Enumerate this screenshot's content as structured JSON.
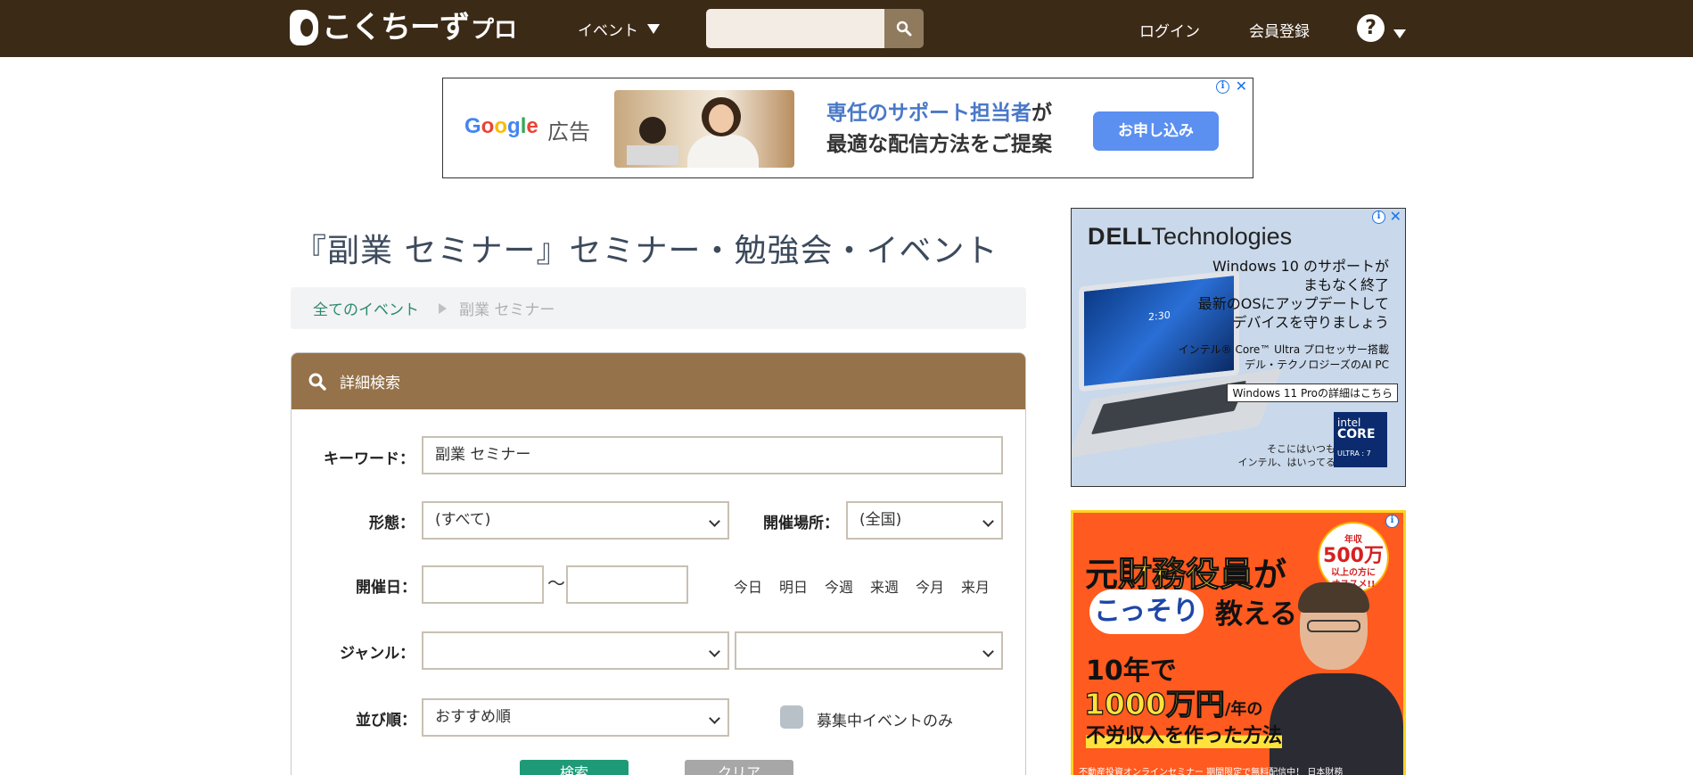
{
  "header": {
    "logo_main": "こくちーず",
    "logo_sub": "プロ",
    "nav_event": "イベント",
    "search_placeholder": "",
    "login": "ログイン",
    "signup": "会員登録",
    "help": "?"
  },
  "ad_top": {
    "brand_label": "広告",
    "copy_line1_highlight": "専任のサポート担当者",
    "copy_line1_rest": "が",
    "copy_line2": "最適な配信方法をご提案",
    "cta": "お申し込み"
  },
  "page": {
    "title": "『副業 セミナー』セミナー・勉強会・イベント"
  },
  "breadcrumb": {
    "home": "全てのイベント",
    "current": "副業 セミナー"
  },
  "search_panel": {
    "heading": "詳細検索",
    "keyword_label": "キーワード：",
    "keyword_value": "副業 セミナー",
    "type_label": "形態：",
    "type_value": "(すべて)",
    "place_label": "開催場所：",
    "place_value": "(全国)",
    "date_label": "開催日：",
    "date_from": "",
    "date_sep": "〜",
    "date_to": "",
    "quick_dates": [
      "今日",
      "明日",
      "今週",
      "来週",
      "今月",
      "来月"
    ],
    "genre_label": "ジャンル：",
    "genre1_value": "",
    "genre2_value": "",
    "sort_label": "並び順：",
    "sort_value": "おすすめ順",
    "open_only_label": "募集中イベントのみ",
    "search_button": "検索",
    "clear_button": "クリア"
  },
  "ad_dell": {
    "logo_d": "D",
    "logo_ell": "ELL",
    "logo_rest": "Technologies",
    "copy1": "Windows 10 のサポートが",
    "copy2": "まもなく終了",
    "copy3": "最新のOSにアップデートして",
    "copy4": "デバイスを守りましょう",
    "small1": "インテル® Core™ Ultra プロセッサー搭載",
    "small2": "デル・テクノロジーズのAI PC",
    "link": "Windows 11 Proの詳細はこちら",
    "note1": "そこにはいつも",
    "note2": "インテル、はいってる",
    "intel1": "intel",
    "intel2": "CORE",
    "intel3": "ULTRA : 7",
    "clock": "2:30"
  },
  "ad_orange": {
    "t1a": "元",
    "t1b": "財務役員",
    "t1c": "が",
    "bubble": "こっそり",
    "teach": "教える",
    "badge1": "年収",
    "badge2": "500万",
    "badge3": "以上の方に",
    "badge4": "オススメ!!",
    "line1": "10年で",
    "num": "1000万円",
    "num_suffix": "/年の",
    "line3": "不労収入を作った方法",
    "footer": "不動産投資オンラインセミナー 期間限定で無料配信中！ 日本財務"
  },
  "colors": {
    "header_bg": "#3b2a16",
    "panel_head_bg": "#957249",
    "accent_green": "#2f8a6a",
    "search_btn_bg": "#1f9a78",
    "clear_btn_bg": "#a7a7a7",
    "ad_cta_bg": "#5b8ff0",
    "ad_orange_bg": "#ff5a1f"
  },
  "icons": {
    "search": "search-icon",
    "dropdown": "chevron-down-icon",
    "help": "help-icon",
    "ad_info": "info-icon",
    "ad_close": "close-icon"
  }
}
